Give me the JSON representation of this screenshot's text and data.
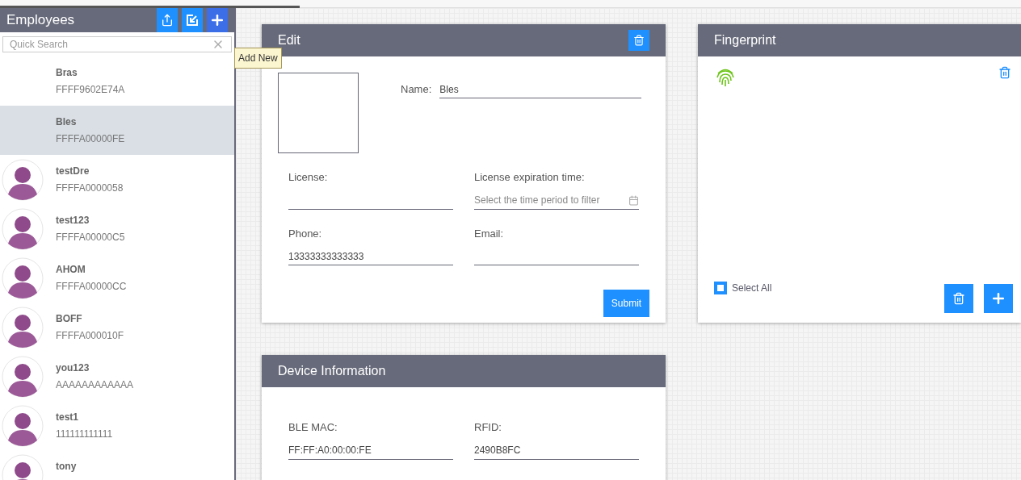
{
  "sidebar": {
    "title": "Employees",
    "tooltip": "Add New",
    "search": {
      "placeholder": "Quick Search"
    },
    "items": [
      {
        "name": "Bras",
        "id": "FFFF9602E74A",
        "avatar": false,
        "selected": false
      },
      {
        "name": "Bles",
        "id": "FFFFA00000FE",
        "avatar": false,
        "selected": true
      },
      {
        "name": "testDre",
        "id": "FFFFA0000058",
        "avatar": true,
        "selected": false
      },
      {
        "name": "test123",
        "id": "FFFFA00000C5",
        "avatar": true,
        "selected": false
      },
      {
        "name": "AHOM",
        "id": "FFFFA00000CC",
        "avatar": true,
        "selected": false
      },
      {
        "name": "BOFF",
        "id": "FFFFA000010F",
        "avatar": true,
        "selected": false
      },
      {
        "name": "you123",
        "id": "AAAAAAAAAAAA",
        "avatar": true,
        "selected": false
      },
      {
        "name": "test1",
        "id": "111111111111",
        "avatar": true,
        "selected": false
      },
      {
        "name": "tony",
        "avatar": true,
        "selected": false
      }
    ]
  },
  "edit": {
    "title": "Edit",
    "name_label": "Name:",
    "name_value": "Bles",
    "fields": [
      {
        "label": "License:"
      },
      {
        "label": "License expiration time:",
        "placeholder": "Select the time period to filter",
        "kind": "date"
      },
      {
        "label": "Phone:",
        "value": "13333333333333"
      },
      {
        "label": "Email:"
      }
    ],
    "submit": "Submit"
  },
  "fingerprint": {
    "title": "Fingerprint",
    "select_all": {
      "label": "Select All",
      "checked": false
    }
  },
  "device": {
    "title": "Device Information",
    "fields": [
      {
        "label": "BLE MAC:",
        "value": "FF:FF:A0:00:00:FE"
      },
      {
        "label": "RFID:",
        "value": "2490B8FC"
      }
    ]
  }
}
